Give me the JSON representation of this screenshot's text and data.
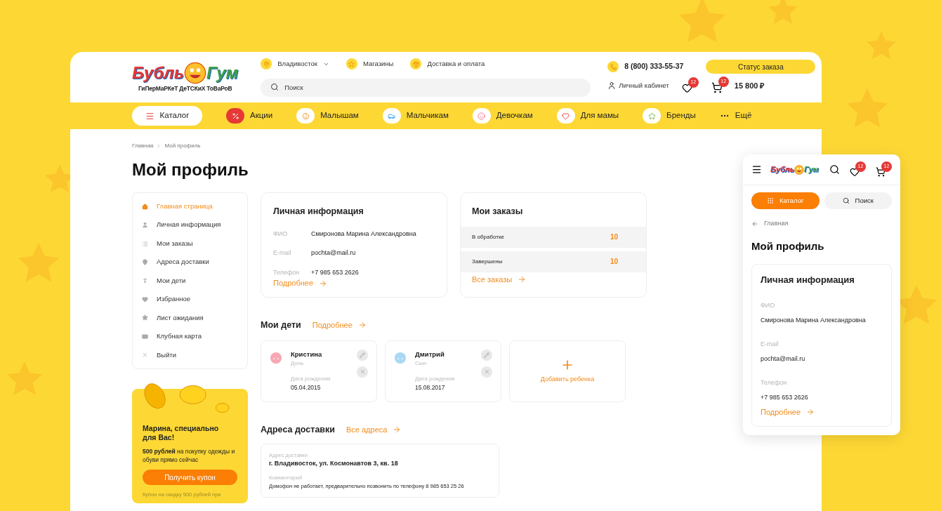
{
  "logo": {
    "word_1": "Бубль",
    "word_2": "Гум",
    "tagline": "ГиПерМаРКеТ ДеТСКиХ ТоВаРоВ"
  },
  "top_links": [
    {
      "kind": "city",
      "label": "Владивосток"
    },
    {
      "kind": "stores",
      "label": "Магазины"
    },
    {
      "kind": "delivery",
      "label": "Доставка и оплата"
    }
  ],
  "phone": "8 (800) 333-55-37",
  "order_status_button": "Статус заказа",
  "search": {
    "placeholder": "Поиск"
  },
  "account_link": "Личный кабинет",
  "favorites_badge": "12",
  "cart_badge": "12",
  "cart_total": "15 800 ₽",
  "catalog_button": "Каталог",
  "nav": [
    {
      "kind": "sale",
      "label": "Акции"
    },
    {
      "kind": "babies",
      "label": "Малышам"
    },
    {
      "kind": "boys",
      "label": "Мальчикам"
    },
    {
      "kind": "girls",
      "label": "Девочкам"
    },
    {
      "kind": "moms",
      "label": "Для мамы"
    },
    {
      "kind": "brands",
      "label": "Бренды"
    },
    {
      "kind": "more",
      "label": "Ещё"
    }
  ],
  "breadcrumbs": [
    "Главная",
    "Мой профиль"
  ],
  "page_title": "Мой профиль",
  "sidebar": {
    "items": [
      {
        "kind": "home",
        "label": "Главная страница",
        "selected": true
      },
      {
        "kind": "person",
        "label": "Личная информация",
        "selected": false
      },
      {
        "kind": "list",
        "label": "Мои заказы",
        "selected": false
      },
      {
        "kind": "pin",
        "label": "Адреса доставки",
        "selected": false
      },
      {
        "kind": "child",
        "label": "Мои дети",
        "selected": false
      },
      {
        "kind": "heart",
        "label": "Избранное",
        "selected": false
      },
      {
        "kind": "star",
        "label": "Лист ожидания",
        "selected": false
      },
      {
        "kind": "card",
        "label": "Клубная карта",
        "selected": false
      },
      {
        "kind": "logout",
        "label": "Выйти",
        "selected": false
      }
    ]
  },
  "personal_info": {
    "title": "Личная информация",
    "fields": [
      {
        "label": "ФИО",
        "value": "Смиронова Марина Александровна"
      },
      {
        "label": "E-mail",
        "value": "pochta@mail.ru"
      },
      {
        "label": "Телефон",
        "value": "+7 985 653 2626"
      }
    ],
    "more_link": "Подробнее"
  },
  "orders": {
    "title": "Мои заказы",
    "rows": [
      {
        "label": "В обработке",
        "count": "10"
      },
      {
        "label": "Завершены",
        "count": "10"
      }
    ],
    "all_link": "Все заказы"
  },
  "children": {
    "title": "Мои дети",
    "more_link": "Подробнее",
    "items": [
      {
        "kind": "girl",
        "name": "Кристина",
        "relation": "Дочь",
        "birth_label": "Дата рождения",
        "birth_date": "05.04.2015"
      },
      {
        "kind": "boy",
        "name": "Дмитрий",
        "relation": "Сын",
        "birth_label": "Дата рождения",
        "birth_date": "15.08.2017"
      }
    ],
    "add_label": "Добавить ребенка"
  },
  "addresses": {
    "title": "Адреса доставки",
    "all_link": "Все адреса",
    "items": [
      {
        "address_label": "Адрес доставки",
        "address": "г. Владивосток, ул. Космонавтов 3, кв. 18",
        "comment_label": "Комментарий",
        "comment": "Домофон не работает, предварительно позвонить по телефону 8 985 653 25 26"
      }
    ]
  },
  "coupon": {
    "heading": "Марина, специально для Вас!",
    "text": "**500 рублей** на покупку одежды и обуви прямо сейчас",
    "button": "Получить купон",
    "note": "Купон на скидку 500 рублей при"
  },
  "mobile": {
    "logo_word_1": "Бубль",
    "logo_word_2": "Гум",
    "favorites_badge": "12",
    "cart_badge": "12",
    "catalog_button": "Каталог",
    "search_button": "Поиск",
    "back_link": "Главная",
    "page_title": "Мой профиль",
    "personal_info": {
      "title": "Личная информация",
      "fields": [
        {
          "label": "ФИО",
          "value": "Смиронова Марина Александровна"
        },
        {
          "label": "E-mail",
          "value": "pochta@mail.ru"
        },
        {
          "label": "Телефон",
          "value": "+7 985 653 2626"
        }
      ],
      "more_link": "Подробнее"
    }
  }
}
